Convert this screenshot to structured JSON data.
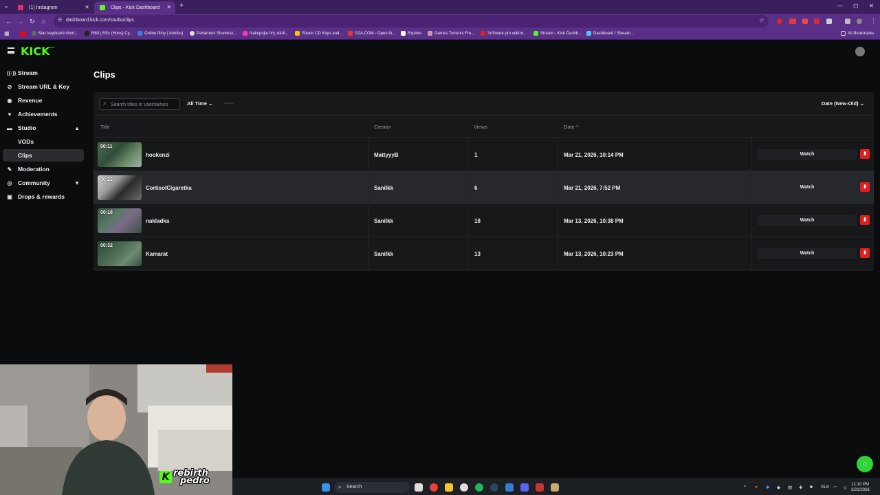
{
  "browser": {
    "tabs": [
      {
        "title": "(1) Instagram",
        "favicon_color": "#e1306c"
      },
      {
        "title": "Clips - Kick Dashboard",
        "favicon_color": "#53fc18"
      }
    ],
    "url": "dashboard.kick.com/studio/clips",
    "bookmarks": [
      "Mac keyboard short...",
      "R60 | BSc (Hons) Cy...",
      "Online filmy | bombuj",
      "Parlament Slovensk...",
      "Nakupujte hry, dárk...",
      "Steam CD Keys and...",
      "G2A.COM - Open th...",
      "Explore",
      "Games Torrents Fre...",
      "Software pro vektor...",
      "Stream - Kick Dashb...",
      "Dashboard / Stream..."
    ],
    "all_bookmarks": "All Bookmarks"
  },
  "app": {
    "logo": "KICK",
    "logo_badge": "BETA"
  },
  "sidebar": {
    "items": [
      {
        "label": "Stream",
        "icon": "stream-icon"
      },
      {
        "label": "Stream URL & Key",
        "icon": "key-icon"
      },
      {
        "label": "Revenue",
        "icon": "revenue-icon"
      },
      {
        "label": "Achievements",
        "icon": "trophy-icon"
      },
      {
        "label": "Studio",
        "icon": "studio-icon"
      },
      {
        "label": "VODs"
      },
      {
        "label": "Clips"
      },
      {
        "label": "Moderation",
        "icon": "wrench-icon"
      },
      {
        "label": "Community",
        "icon": "community-icon"
      },
      {
        "label": "Drops & rewards",
        "icon": "gift-icon"
      }
    ]
  },
  "page": {
    "title": "Clips"
  },
  "toolbar": {
    "search_placeholder": "Search titles or usernames",
    "time_filter": "All Time",
    "sort": "Date (New-Old)"
  },
  "table": {
    "headers": {
      "title": "Title",
      "creator": "Creator",
      "views": "Views",
      "date": "Date"
    },
    "watch_label": "Watch",
    "rows": [
      {
        "duration": "00:11",
        "title": "hookenzi",
        "creator": "MattyyyB",
        "views": "1",
        "date": "Mar 21, 2026, 10:14 PM"
      },
      {
        "duration": "00:22",
        "title": "CortisolCigaretka",
        "creator": "Sanilkk",
        "views": "6",
        "date": "Mar 21, 2026, 7:52 PM"
      },
      {
        "duration": "00:18",
        "title": "nakladka",
        "creator": "Sanilkk",
        "views": "18",
        "date": "Mar 13, 2026, 10:38 PM"
      },
      {
        "duration": "00:32",
        "title": "Kamarat",
        "creator": "Sanilkk",
        "views": "13",
        "date": "Mar 13, 2026, 10:23 PM"
      }
    ]
  },
  "overlay": {
    "logo_line1": "rebirth",
    "logo_line2": "pedro"
  },
  "taskbar": {
    "search": "Search",
    "lang": "SLK",
    "time": "11:10 PM",
    "date": "3/21/2026"
  },
  "colors": {
    "kick_green": "#53fc18",
    "delete_red": "#e0201f",
    "chrome_purple": "#5a2f87"
  }
}
